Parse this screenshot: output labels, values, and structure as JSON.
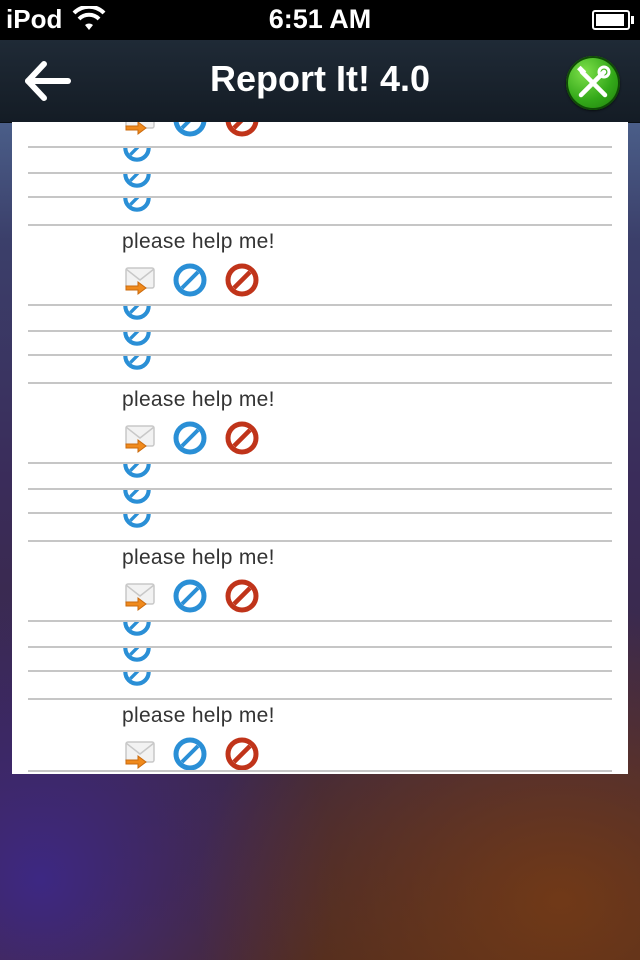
{
  "status_bar": {
    "carrier": "iPod",
    "time": "6:51 AM"
  },
  "nav_bar": {
    "title": "Report It! 4.0"
  },
  "messages": [
    {
      "text": "please help me!",
      "actions": [
        "reply-mail-icon",
        "approve-icon",
        "block-icon"
      ]
    },
    {
      "text": "please help me!",
      "actions": [
        "reply-mail-icon",
        "approve-icon",
        "block-icon"
      ]
    },
    {
      "text": "please help me!",
      "actions": [
        "reply-mail-icon",
        "approve-icon",
        "block-icon"
      ]
    },
    {
      "text": "please help me!",
      "actions": [
        "reply-mail-icon",
        "approve-icon",
        "block-icon"
      ]
    }
  ],
  "colors": {
    "nav_bg": "#18212c",
    "settings_green": "#33a819",
    "approve_blue": "#2a8fd6",
    "block_red": "#c0341a",
    "mail_orange": "#f08a1c",
    "divider": "#c6c6c6"
  }
}
